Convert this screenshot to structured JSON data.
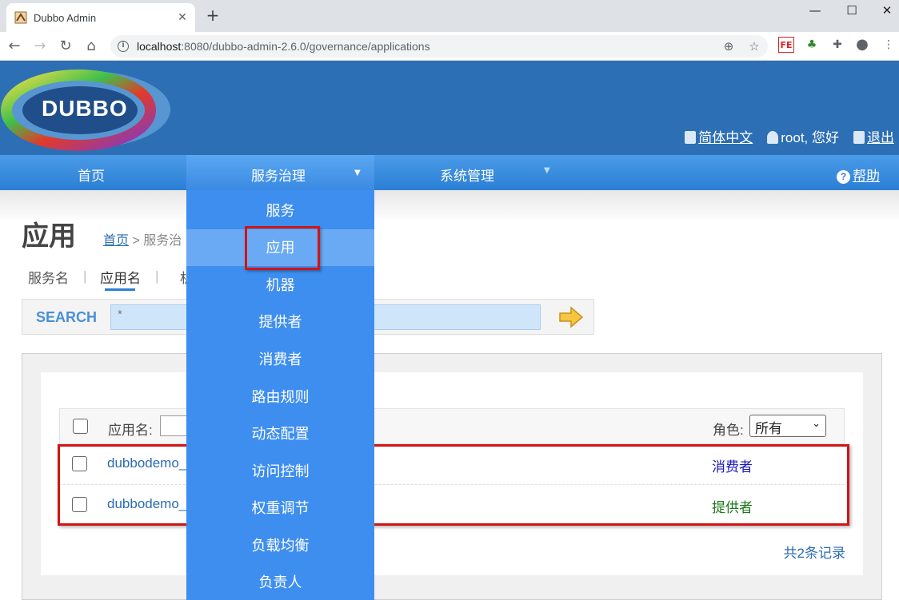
{
  "browser": {
    "tab_title": "Dubbo Admin",
    "url_host": "localhost",
    "url_rest": ":8080/dubbo-admin-2.6.0/governance/applications",
    "window_controls": [
      "minimize-icon",
      "maximize-icon",
      "close-icon"
    ]
  },
  "header": {
    "logo_text": "DUBBO",
    "language": "简体中文",
    "greeting": "root, 您好",
    "logout": "退出"
  },
  "nav": {
    "home": "首页",
    "governance": "服务治理",
    "system": "系统管理",
    "help": "帮助"
  },
  "dropdown": {
    "title": "服务治理",
    "items": [
      "服务",
      "应用",
      "机器",
      "提供者",
      "消费者",
      "路由规则",
      "动态配置",
      "访问控制",
      "权重调节",
      "负载均衡",
      "负责人"
    ],
    "active_index": 1
  },
  "page": {
    "title": "应用",
    "breadcrumb_home": "首页",
    "breadcrumb_rest": "> 服务治",
    "subtabs": [
      "服务名",
      "应用名",
      "机"
    ],
    "active_subtab": "应用名"
  },
  "search": {
    "label": "SEARCH",
    "value": "*"
  },
  "table": {
    "filter_label": "应用名:",
    "role_label": "角色:",
    "role_selected": "所有",
    "rows": [
      {
        "app": "dubbodemo_",
        "role": "消费者",
        "role_color": "#1a1ab8"
      },
      {
        "app": "dubbodemo_",
        "role": "提供者",
        "role_color": "#1a7a1a"
      }
    ],
    "footer": "共2条记录"
  }
}
